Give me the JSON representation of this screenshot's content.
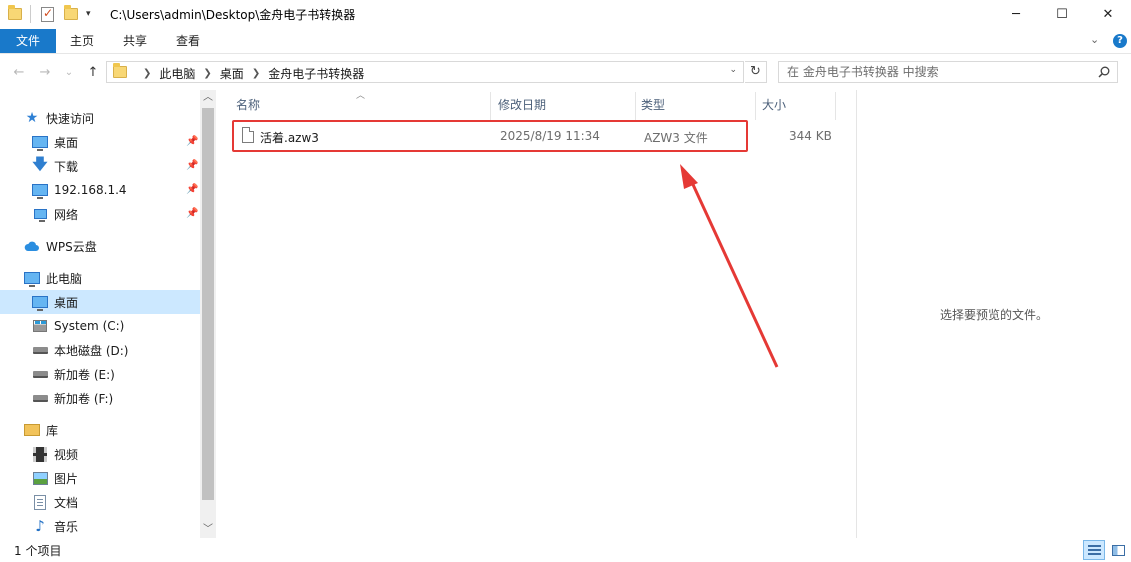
{
  "window": {
    "title_path": "C:\\Users\\admin\\Desktop\\金舟电子书转换器",
    "controls": {
      "minimize": "─",
      "maximize": "☐",
      "close": "✕"
    }
  },
  "ribbon": {
    "tabs": [
      "文件",
      "主页",
      "共享",
      "查看"
    ],
    "expand_glyph": "⌄",
    "help_glyph": "?"
  },
  "nav": {
    "back": "←",
    "forward": "→",
    "recent": "⌄",
    "up": "↑",
    "breadcrumb": [
      "此电脑",
      "桌面",
      "金舟电子书转换器"
    ],
    "refresh": "↻"
  },
  "search": {
    "placeholder": "在 金舟电子书转换器 中搜索"
  },
  "sidebar": {
    "items": [
      {
        "label": "快速访问",
        "icon": "star-icon"
      },
      {
        "label": "桌面",
        "icon": "desktop-icon",
        "pinned": true
      },
      {
        "label": "下载",
        "icon": "download-icon",
        "pinned": true
      },
      {
        "label": "192.168.1.4",
        "icon": "network-computer-icon",
        "pinned": true
      },
      {
        "label": "网络",
        "icon": "network-icon",
        "pinned": true
      },
      {
        "label": "WPS云盘",
        "icon": "cloud-icon"
      },
      {
        "label": "此电脑",
        "icon": "pc-icon"
      },
      {
        "label": "桌面",
        "icon": "desktop-icon",
        "selected": true
      },
      {
        "label": "System (C:)",
        "icon": "system-drive-icon"
      },
      {
        "label": "本地磁盘 (D:)",
        "icon": "drive-icon"
      },
      {
        "label": "新加卷 (E:)",
        "icon": "drive-icon"
      },
      {
        "label": "新加卷 (F:)",
        "icon": "drive-icon"
      },
      {
        "label": "库",
        "icon": "library-icon"
      },
      {
        "label": "视频",
        "icon": "video-icon"
      },
      {
        "label": "图片",
        "icon": "pictures-icon"
      },
      {
        "label": "文档",
        "icon": "documents-icon"
      },
      {
        "label": "音乐",
        "icon": "music-icon"
      }
    ]
  },
  "filelist": {
    "columns": [
      "名称",
      "修改日期",
      "类型",
      "大小"
    ],
    "rows": [
      {
        "name": "活着.azw3",
        "modified": "2025/8/19 11:34",
        "type": "AZW3 文件",
        "size": "344 KB"
      }
    ]
  },
  "preview": {
    "empty_text": "选择要预览的文件。"
  },
  "status": {
    "item_count": "1 个项目"
  },
  "colors": {
    "accent": "#1979ca",
    "selection": "#cce8ff",
    "highlight_box": "#e53935"
  }
}
